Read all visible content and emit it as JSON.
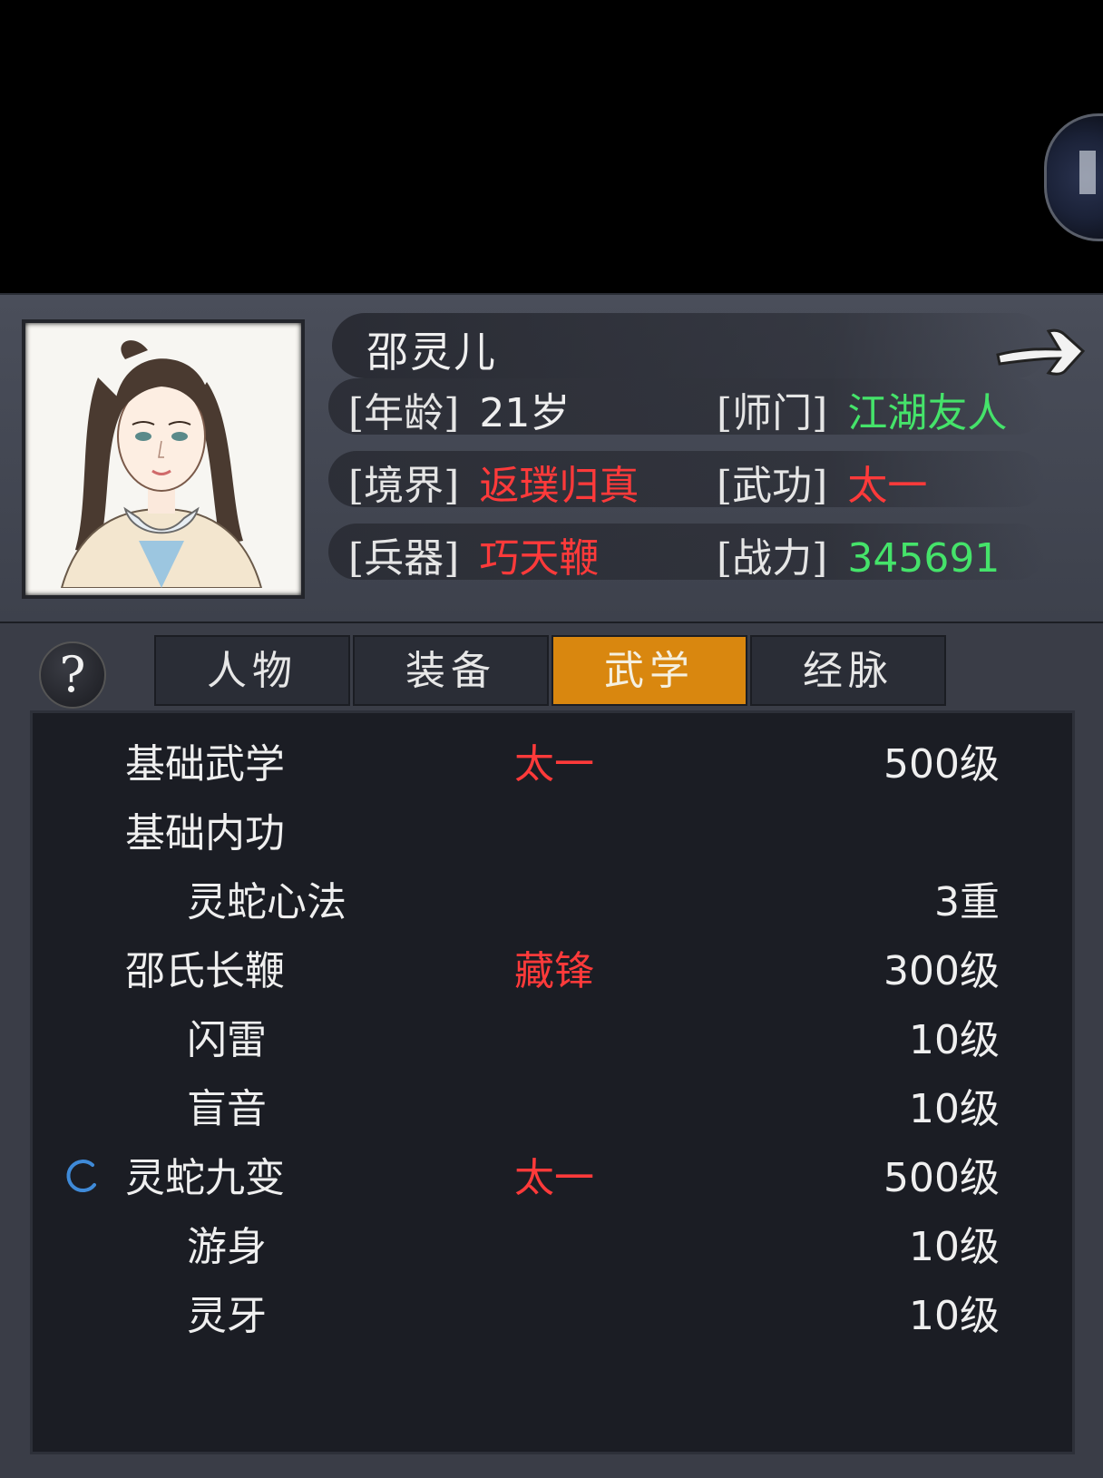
{
  "character": {
    "name": "邵灵儿",
    "attributes": [
      {
        "key": "[年龄]",
        "value": "21岁",
        "color": "white"
      },
      {
        "key": "[师门]",
        "value": "江湖友人",
        "color": "green"
      },
      {
        "key": "[境界]",
        "value": "返璞归真",
        "color": "red"
      },
      {
        "key": "[武功]",
        "value": "太一",
        "color": "red"
      },
      {
        "key": "[兵器]",
        "value": "巧天鞭",
        "color": "red"
      },
      {
        "key": "[战力]",
        "value": "345691",
        "color": "green"
      }
    ]
  },
  "tabs": [
    {
      "label": "人物",
      "active": false
    },
    {
      "label": "装备",
      "active": false
    },
    {
      "label": "武学",
      "active": true
    },
    {
      "label": "经脉",
      "active": false
    }
  ],
  "skills": [
    {
      "name": "基础武学",
      "indent": false,
      "stage": "太一",
      "level": "500级",
      "active_icon": false
    },
    {
      "name": "基础内功",
      "indent": false,
      "stage": "",
      "level": "",
      "active_icon": false
    },
    {
      "name": "灵蛇心法",
      "indent": true,
      "stage": "",
      "level": "3重",
      "active_icon": false
    },
    {
      "name": "邵氏长鞭",
      "indent": false,
      "stage": "藏锋",
      "level": "300级",
      "active_icon": false
    },
    {
      "name": "闪雷",
      "indent": true,
      "stage": "",
      "level": "10级",
      "active_icon": false
    },
    {
      "name": "盲音",
      "indent": true,
      "stage": "",
      "level": "10级",
      "active_icon": false
    },
    {
      "name": "灵蛇九变",
      "indent": false,
      "stage": "太一",
      "level": "500级",
      "active_icon": true
    },
    {
      "name": "游身",
      "indent": true,
      "stage": "",
      "level": "10级",
      "active_icon": false
    },
    {
      "name": "灵牙",
      "indent": true,
      "stage": "",
      "level": "10级",
      "active_icon": false
    }
  ],
  "icons": {
    "help": "?",
    "next": "arrow-right-icon",
    "spinner": "loading-spinner-icon"
  },
  "colors": {
    "red": "#ff3a3a",
    "green": "#45e36a",
    "tab_active": "#d9870f"
  }
}
